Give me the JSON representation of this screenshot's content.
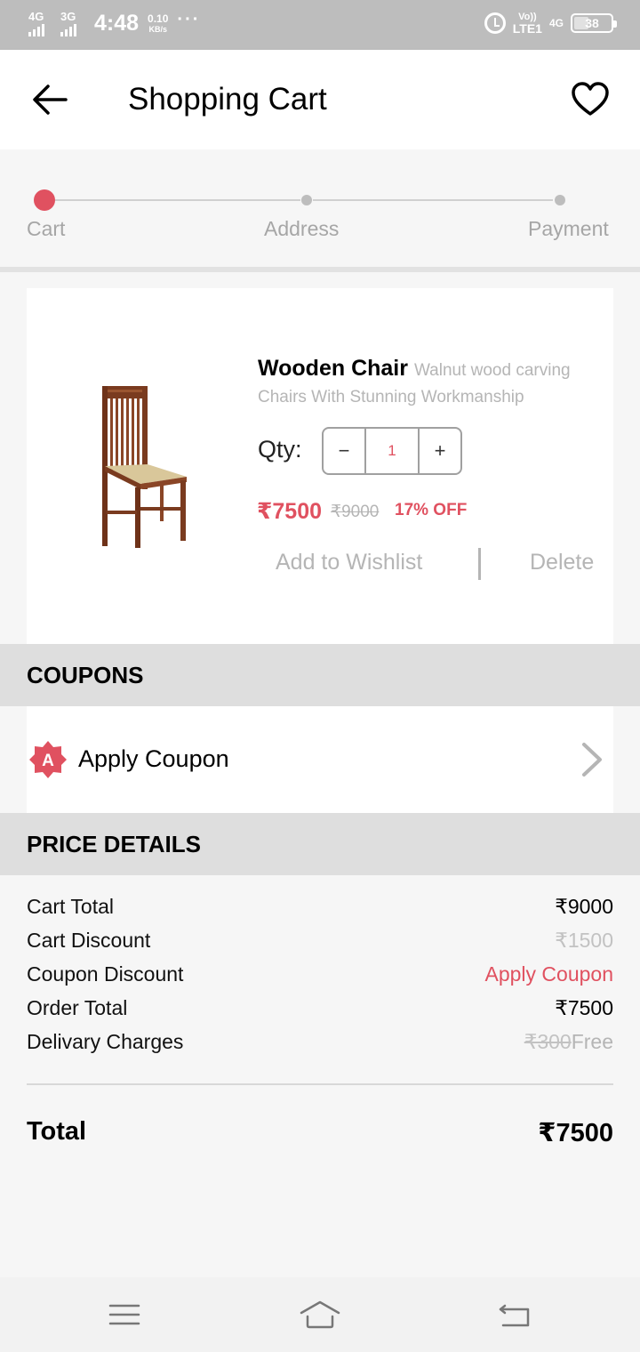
{
  "status_bar": {
    "network_1": "4G",
    "network_2": "3G",
    "time": "4:48",
    "speed_value": "0.10",
    "speed_unit": "KB/s",
    "more": "···",
    "volte_top": "Vo))",
    "volte_bottom": "LTE1",
    "network_right": "4G",
    "battery": "38"
  },
  "header": {
    "title": "Shopping Cart",
    "back_icon": "arrow-left-icon",
    "wishlist_icon": "heart-icon"
  },
  "steps": [
    {
      "label": "Cart",
      "active": true
    },
    {
      "label": "Address",
      "active": false
    },
    {
      "label": "Payment",
      "active": false
    }
  ],
  "product": {
    "name": "Wooden Chair",
    "description": "Walnut wood carving Chairs With Stunning Workmanship",
    "qty_label": "Qty:",
    "qty_minus": "−",
    "qty_value": "1",
    "qty_plus": "+",
    "price": "₹7500",
    "mrp": "₹9000",
    "discount": "17% OFF",
    "wishlist_action": "Add to Wishlist",
    "delete_action": "Delete"
  },
  "coupons": {
    "heading": "COUPONS",
    "badge": "A",
    "apply_label": "Apply Coupon"
  },
  "price_details": {
    "heading": "PRICE DETAILS",
    "cart_total_label": "Cart Total",
    "cart_total_value": "₹9000",
    "cart_discount_label": "Cart Discount",
    "cart_discount_value": "₹1500",
    "coupon_discount_label": "Coupon Discount",
    "coupon_discount_value": "Apply Coupon",
    "order_total_label": "Order Total",
    "order_total_value": "₹7500",
    "delivery_label": "Delivary Charges",
    "delivery_old": "₹300",
    "delivery_new": "Free",
    "total_label": "Total",
    "total_value": "₹7500"
  },
  "colors": {
    "accent": "#e05160",
    "muted": "#b5b5b5",
    "section_bg": "#dedede"
  },
  "nav": {
    "menu_icon": "menu-icon",
    "home_icon": "home-icon",
    "back_icon": "back-icon"
  }
}
